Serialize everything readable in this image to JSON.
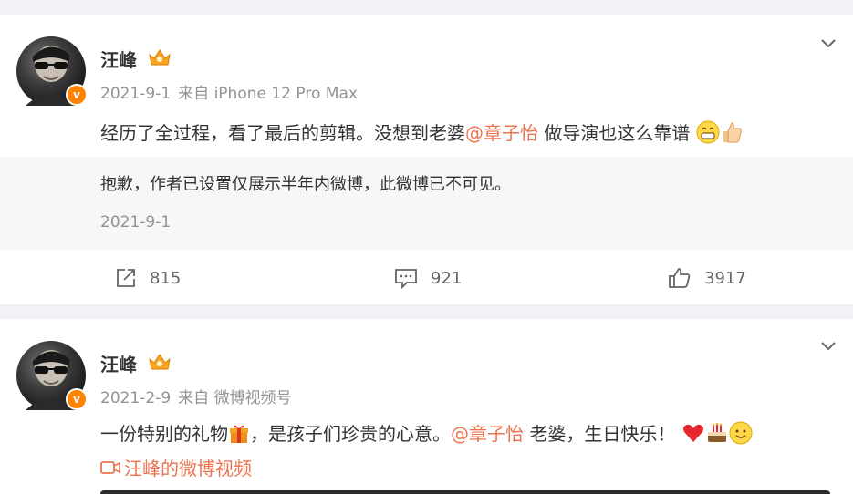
{
  "posts": [
    {
      "author": "汪峰",
      "date": "2021-9-1",
      "source": "来自 iPhone 12 Pro Max",
      "content_before": "经历了全过程，看了最后的剪辑。没想到老婆",
      "mention": "@章子怡",
      "content_after": " 做导演也这么靠谱",
      "repost": {
        "text": "抱歉，作者已设置仅展示半年内微博，此微博已不可见。",
        "date": "2021-9-1"
      },
      "actions": {
        "share": "815",
        "comment": "921",
        "like": "3917"
      }
    },
    {
      "author": "汪峰",
      "date": "2021-2-9",
      "source": "来自 微博视频号",
      "content_before": "一份特别的礼物",
      "content_mid": "，是孩子们珍贵的心意。",
      "mention": "@章子怡",
      "content_after": " 老婆，生日快乐！",
      "video_link": "汪峰的微博视频"
    }
  ],
  "colors": {
    "accent": "#eb7350",
    "verified": "#ff8200",
    "gray": "#939393"
  },
  "icons": [
    "chevron-down-icon",
    "vip-crown-icon",
    "verified-badge-icon",
    "share-icon",
    "comment-icon",
    "like-icon",
    "video-icon",
    "grin-emoji",
    "thumbs-up-emoji",
    "gift-emoji",
    "heart-emoji",
    "cake-emoji",
    "smile-emoji"
  ]
}
